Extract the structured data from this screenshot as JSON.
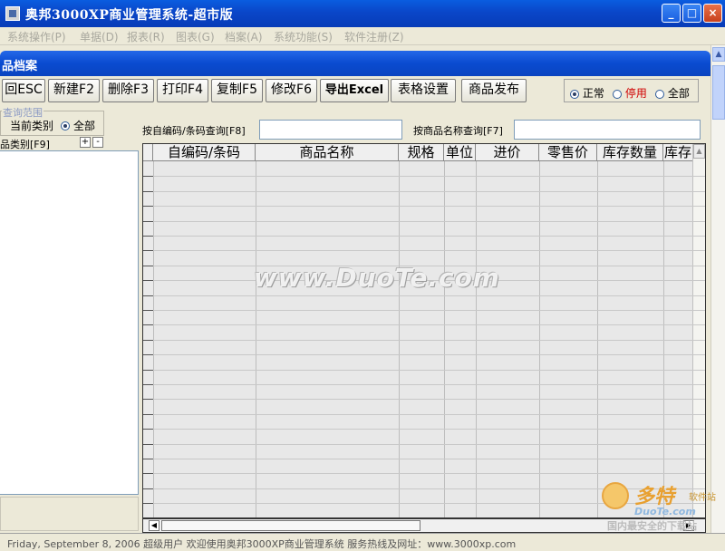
{
  "window": {
    "title": "奥邦3000XP商业管理系统-超市版",
    "minimize": "_",
    "maximize": "□",
    "close": "×"
  },
  "menu": [
    "系统操作(P)",
    "单据(D)",
    "报表(R)",
    "图表(G)",
    "档案(A)",
    "系统功能(S)",
    "软件注册(Z)"
  ],
  "subwindow": {
    "title": "品档案"
  },
  "toolbar": {
    "buttons": [
      "回ESC",
      "新建F2",
      "删除F3",
      "打印F4",
      "复制F5",
      "修改F6",
      "导出Excel",
      "表格设置",
      "商品发布"
    ]
  },
  "status_filter": {
    "options": [
      "正常",
      "停用",
      "全部"
    ],
    "selected": "正常",
    "stop_color": "#d00000"
  },
  "scope": {
    "legend": "查询范围",
    "current": "当前类别",
    "all": "全部",
    "selected": "全部"
  },
  "tree": {
    "label": "品类别[F9]",
    "plus": "+",
    "minus": "-"
  },
  "search": {
    "by_code_label": "按自编码/条码查询[F8]",
    "by_code_value": "",
    "by_name_label": "按商品名称查询[F7]",
    "by_name_value": ""
  },
  "grid": {
    "columns": [
      "自编码/条码",
      "商品名称",
      "规格",
      "单位",
      "进价",
      "零售价",
      "库存数量",
      "库存"
    ],
    "rows": []
  },
  "statusbar": {
    "text": "Friday, September 8, 2006      超级用户      欢迎使用奥邦3000XP商业管理系统       服务热线及网址：www.3000xp.com"
  },
  "watermark": {
    "site": "www.DuoTe.com",
    "logo_main": "多特",
    "logo_small": "软件站",
    "logo_site": "DuoTe.com",
    "logo_slogan": "国内最安全的下载站"
  }
}
